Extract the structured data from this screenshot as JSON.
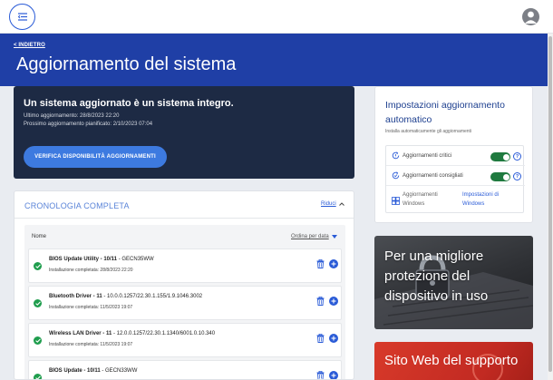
{
  "header": {
    "menu_icon": "menu-collapse-icon",
    "user_icon": "user-avatar-icon"
  },
  "hero": {
    "back_label": "< INDIETRO",
    "title": "Aggiornamento del sistema"
  },
  "status": {
    "headline": "Un sistema aggiornato è un sistema integro.",
    "last_update": "Ultimo aggiornamento: 28/8/2023 22:20",
    "next_update": "Prossimo aggiornamento pianificato: 2/10/2023 07:04",
    "check_button": "VERIFICA DISPONIBILITÀ AGGIORNAMENTI"
  },
  "history": {
    "title": "CRONOLOGIA COMPLETA",
    "collapse_label": "Riduci",
    "column_name": "Nome",
    "sort_label": "Ordina per data",
    "rows": [
      {
        "name": "BIOS Update Utility - 10/11",
        "version": " - GECN35WW",
        "installed": "Installazione completata: 28/8/2023 22:20"
      },
      {
        "name": "Bluetooth Driver - 11",
        "version": " - 10.0.0.1257/22.30.1.155/1.9.1046.3002",
        "installed": "Installazione completata: 11/5/2023 19:07"
      },
      {
        "name": "Wireless LAN Driver - 11",
        "version": " - 12.0.0.1257/22.30.1.1340/6001.0.10.340",
        "installed": "Installazione completata: 11/5/2023 19:07"
      },
      {
        "name": "BIOS Update - 10/11",
        "version": " - GECN33WW",
        "installed": ""
      }
    ]
  },
  "settings": {
    "title": "Impostazioni aggiornamento automatico",
    "subtitle": "Installa automaticamente gli aggiornamenti",
    "critical_label": "Aggiornamenti critici",
    "recommended_label": "Aggiornamenti consigliati",
    "windows_label": "Aggiornamenti Windows",
    "windows_link": "Impostazioni di Windows",
    "help_glyph": "?",
    "accent": "#1f7a3f"
  },
  "promos": {
    "protection": "Per una migliore protezione del dispositivo in uso",
    "support": "Sito Web del supporto"
  },
  "colors": {
    "hero": "#1f3fa6",
    "status_card": "#1d2a44",
    "primary_button": "#3d7ae0",
    "success": "#1f9d4d"
  }
}
